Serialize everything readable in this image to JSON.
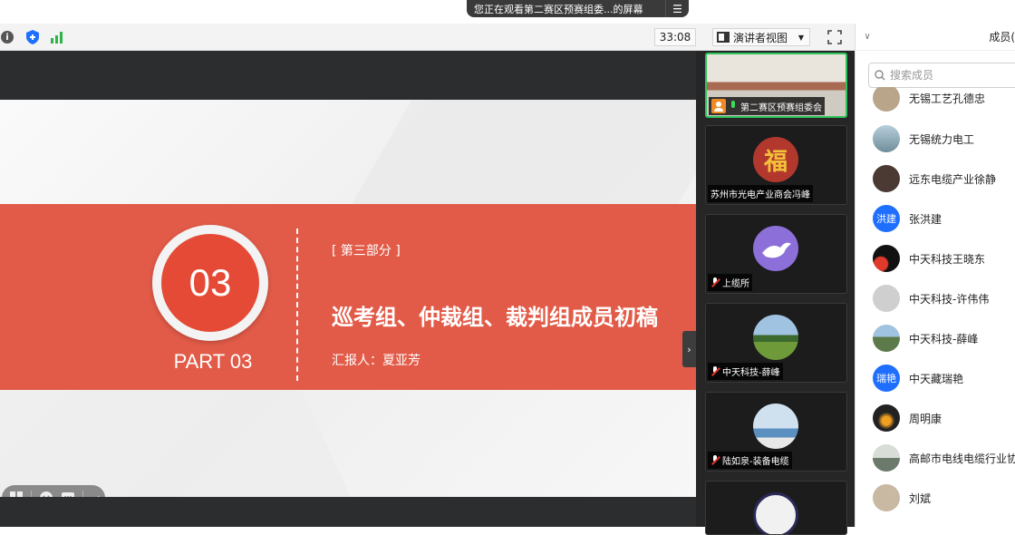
{
  "share_banner": {
    "text": "您正在观看第二赛区预赛组委...的屏幕",
    "menu_icon": "menu-icon"
  },
  "toolbar": {
    "timer": "33:08",
    "view_button_label": "演讲者视图",
    "icons": [
      "info-icon",
      "shield-icon",
      "signal-icon",
      "fullscreen-icon"
    ]
  },
  "slide": {
    "number": "03",
    "part_label": "PART 03",
    "section_tag": "[ 第三部分 ]",
    "title": "巡考组、仲裁组、裁判组成员初稿",
    "reporter": "汇报人：夏亚芳",
    "colors": {
      "band": "#e25b48",
      "circle": "#e54a36"
    }
  },
  "video_tiles": [
    {
      "name": "第二赛区预赛组委会",
      "mic": "on",
      "host": true
    },
    {
      "name": "苏州市光电产业商会冯峰",
      "mic": "none"
    },
    {
      "name": "上缆所",
      "mic": "off"
    },
    {
      "name": "中天科技-薛峰",
      "mic": "off"
    },
    {
      "name": "陆如泉-装备电缆",
      "mic": "off"
    },
    {
      "name": "",
      "mic": "none"
    }
  ],
  "panel": {
    "title": "成员(",
    "search_placeholder": "搜索成员",
    "members": [
      {
        "name": "无锡工艺孔德忠",
        "avatar_color": "#b9a58a"
      },
      {
        "name": "无锡统力电工",
        "avatar_color": "#7e9aa7"
      },
      {
        "name": "远东电缆产业徐静",
        "avatar_color": "#4a3a33"
      },
      {
        "name": "张洪建",
        "avatar_text": "洪建",
        "avatar_color": "#1e6fff"
      },
      {
        "name": "中天科技王晓东",
        "avatar_color": "#1a1a1a"
      },
      {
        "name": "中天科技-许伟伟",
        "avatar_color": "#cfcfcf"
      },
      {
        "name": "中天科技-薛峰",
        "avatar_color": "#5d7a4a"
      },
      {
        "name": "中天藏瑞艳",
        "avatar_text": "瑞艳",
        "avatar_color": "#1e6fff"
      },
      {
        "name": "周明康",
        "avatar_color": "#2a2a2a"
      },
      {
        "name": "高邮市电线电缆行业协",
        "avatar_color": "#8a8f88"
      },
      {
        "name": "刘斌",
        "avatar_color": "#c9b8a2"
      }
    ]
  }
}
